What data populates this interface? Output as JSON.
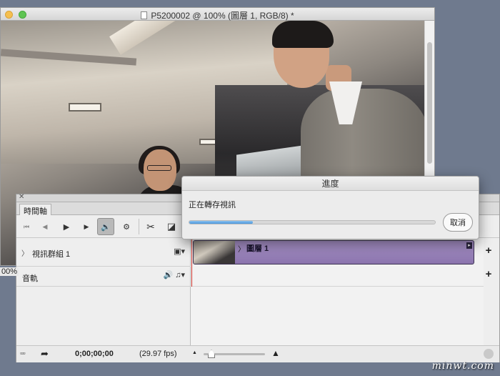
{
  "document": {
    "title": "P5200002 @ 100% (圖層 1, RGB/8) *",
    "zoom_fragment": "00%"
  },
  "timeline": {
    "tab_label": "時間軸",
    "tools": {
      "first_frame_icon": "⏮",
      "prev_frame_icon": "◀",
      "play_icon": "▶",
      "next_frame_icon": "▶",
      "audio_icon": "🔊",
      "settings_icon": "⚙",
      "split_icon": "✂",
      "transition_icon": "◪"
    },
    "tracks": {
      "video_group_label": "視訊群組 1",
      "video_group_icons": "▣▾",
      "audio_label": "音軌",
      "audio_icons": "🔊 ♫▾",
      "caret": "〉",
      "add_symbol": "+"
    },
    "clip": {
      "label": "圖層 1",
      "end_marker": "▸"
    },
    "footer": {
      "render_icon": "▫▫▫",
      "convert_icon": "➦",
      "timecode": "0;00;00;00",
      "fps": "(29.97 fps)",
      "zoom_out_icon": "▲",
      "zoom_in_icon": "▲",
      "zoom_level": 0.1
    }
  },
  "progress_dialog": {
    "title": "進度",
    "status": "正在轉存視訊",
    "progress": 0.26,
    "cancel_label": "取消",
    "accent": "#4a97dd"
  },
  "watermark": "minwt.com"
}
